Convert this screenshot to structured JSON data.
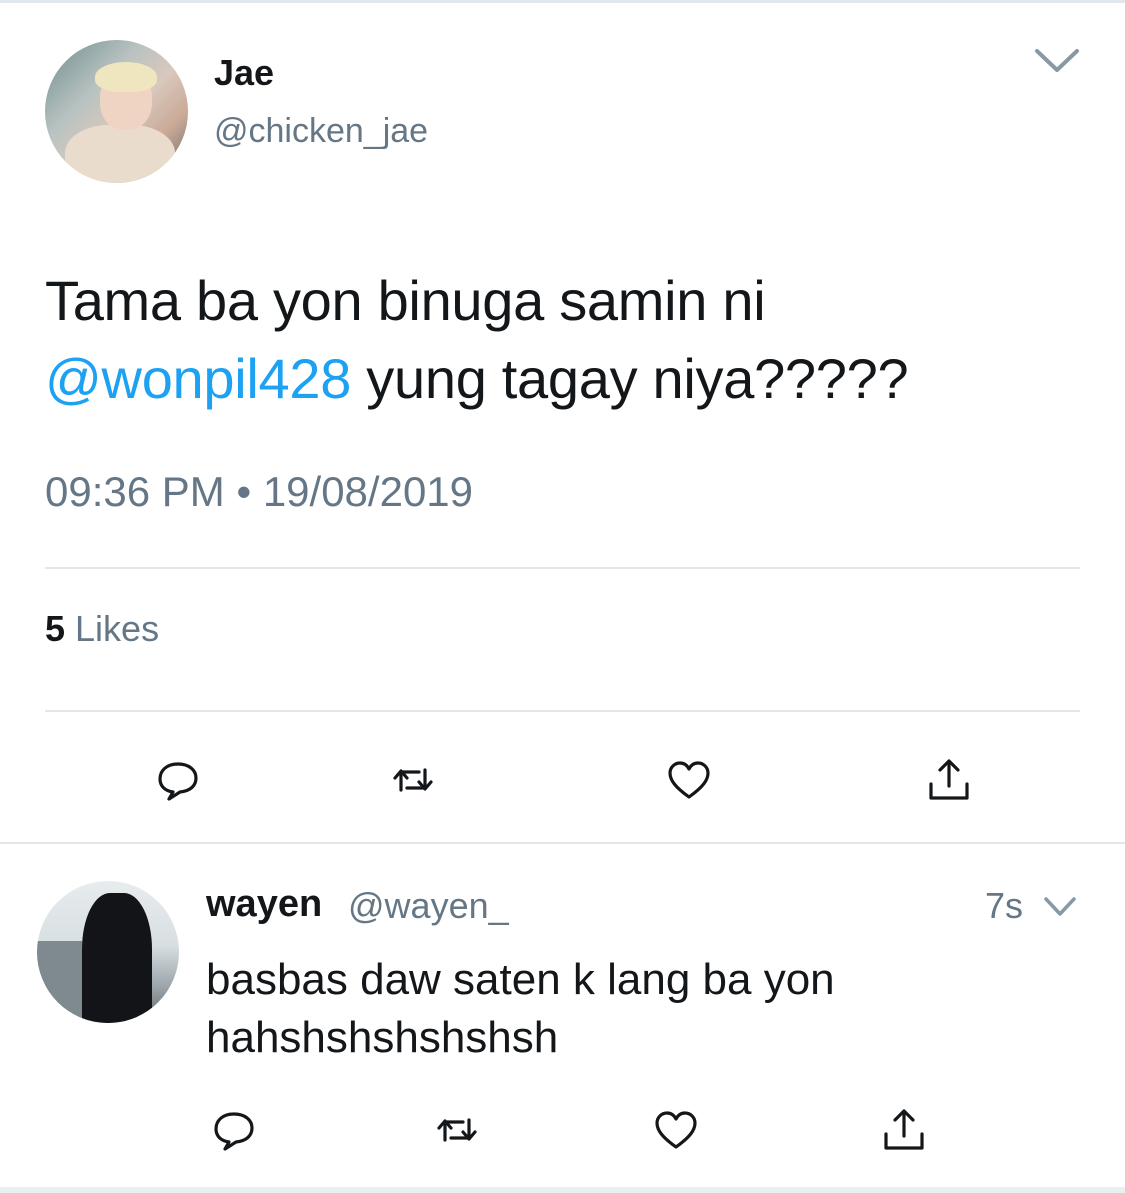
{
  "main_tweet": {
    "author_name": "Jae",
    "author_handle": "@chicken_jae",
    "text_before": "Tama ba yon binuga samin ni",
    "mention": "@wonpil428",
    "text_after": " yung tagay niya?????",
    "timestamp": "09:36 PM • 19/08/2019",
    "likes_count": "5",
    "likes_label": "Likes"
  },
  "reply": {
    "author_name": "wayen",
    "author_handle": "@wayen_",
    "time_ago": "7s",
    "text": "basbas daw saten k lang ba yon hahshshshshshsh"
  },
  "colors": {
    "link": "#1da1f2",
    "muted": "#657786",
    "text": "#14171a",
    "divider": "#e1e8ed"
  },
  "icons": [
    "reply-icon",
    "retweet-icon",
    "like-icon",
    "share-icon",
    "chevron-down-icon"
  ]
}
